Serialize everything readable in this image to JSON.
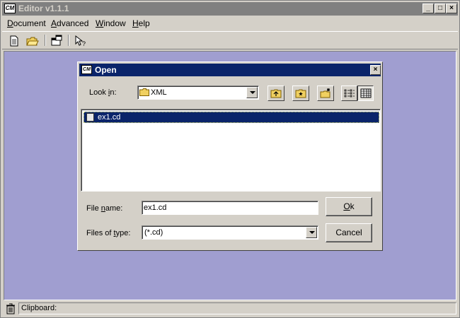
{
  "window": {
    "title": "Editor v1.1.1",
    "app_icon_text": "CM"
  },
  "menu": [
    {
      "label_u": "D",
      "label_rest": "ocument"
    },
    {
      "label_u": "A",
      "label_rest": "dvanced"
    },
    {
      "label_u": "W",
      "label_rest": "indow"
    },
    {
      "label_u": "H",
      "label_rest": "elp"
    }
  ],
  "toolbar": {
    "icons": [
      "new-document-icon",
      "open-folder-icon",
      "properties-icon",
      "context-help-icon"
    ]
  },
  "dialog": {
    "title": "Open",
    "look_in_label_pre": "Look ",
    "look_in_label_u": "i",
    "look_in_label_post": "n:",
    "look_in_value": "XML",
    "files": [
      {
        "name": "ex1.cd",
        "selected": true
      }
    ],
    "file_name_label_pre": "File ",
    "file_name_label_u": "n",
    "file_name_label_post": "ame:",
    "file_name_value": "ex1.cd",
    "file_type_label_pre": "Files of ",
    "file_type_label_u": "t",
    "file_type_label_post": "ype:",
    "file_type_value": "(*.cd)",
    "ok_u": "O",
    "ok_rest": "k",
    "cancel_label": "Cancel"
  },
  "status": {
    "clipboard_label": "Clipboard:"
  },
  "colors": {
    "workspace": "#a09ed0",
    "active_title": "#0a246a",
    "inactive_title": "#808080",
    "face": "#d4d0c8"
  }
}
